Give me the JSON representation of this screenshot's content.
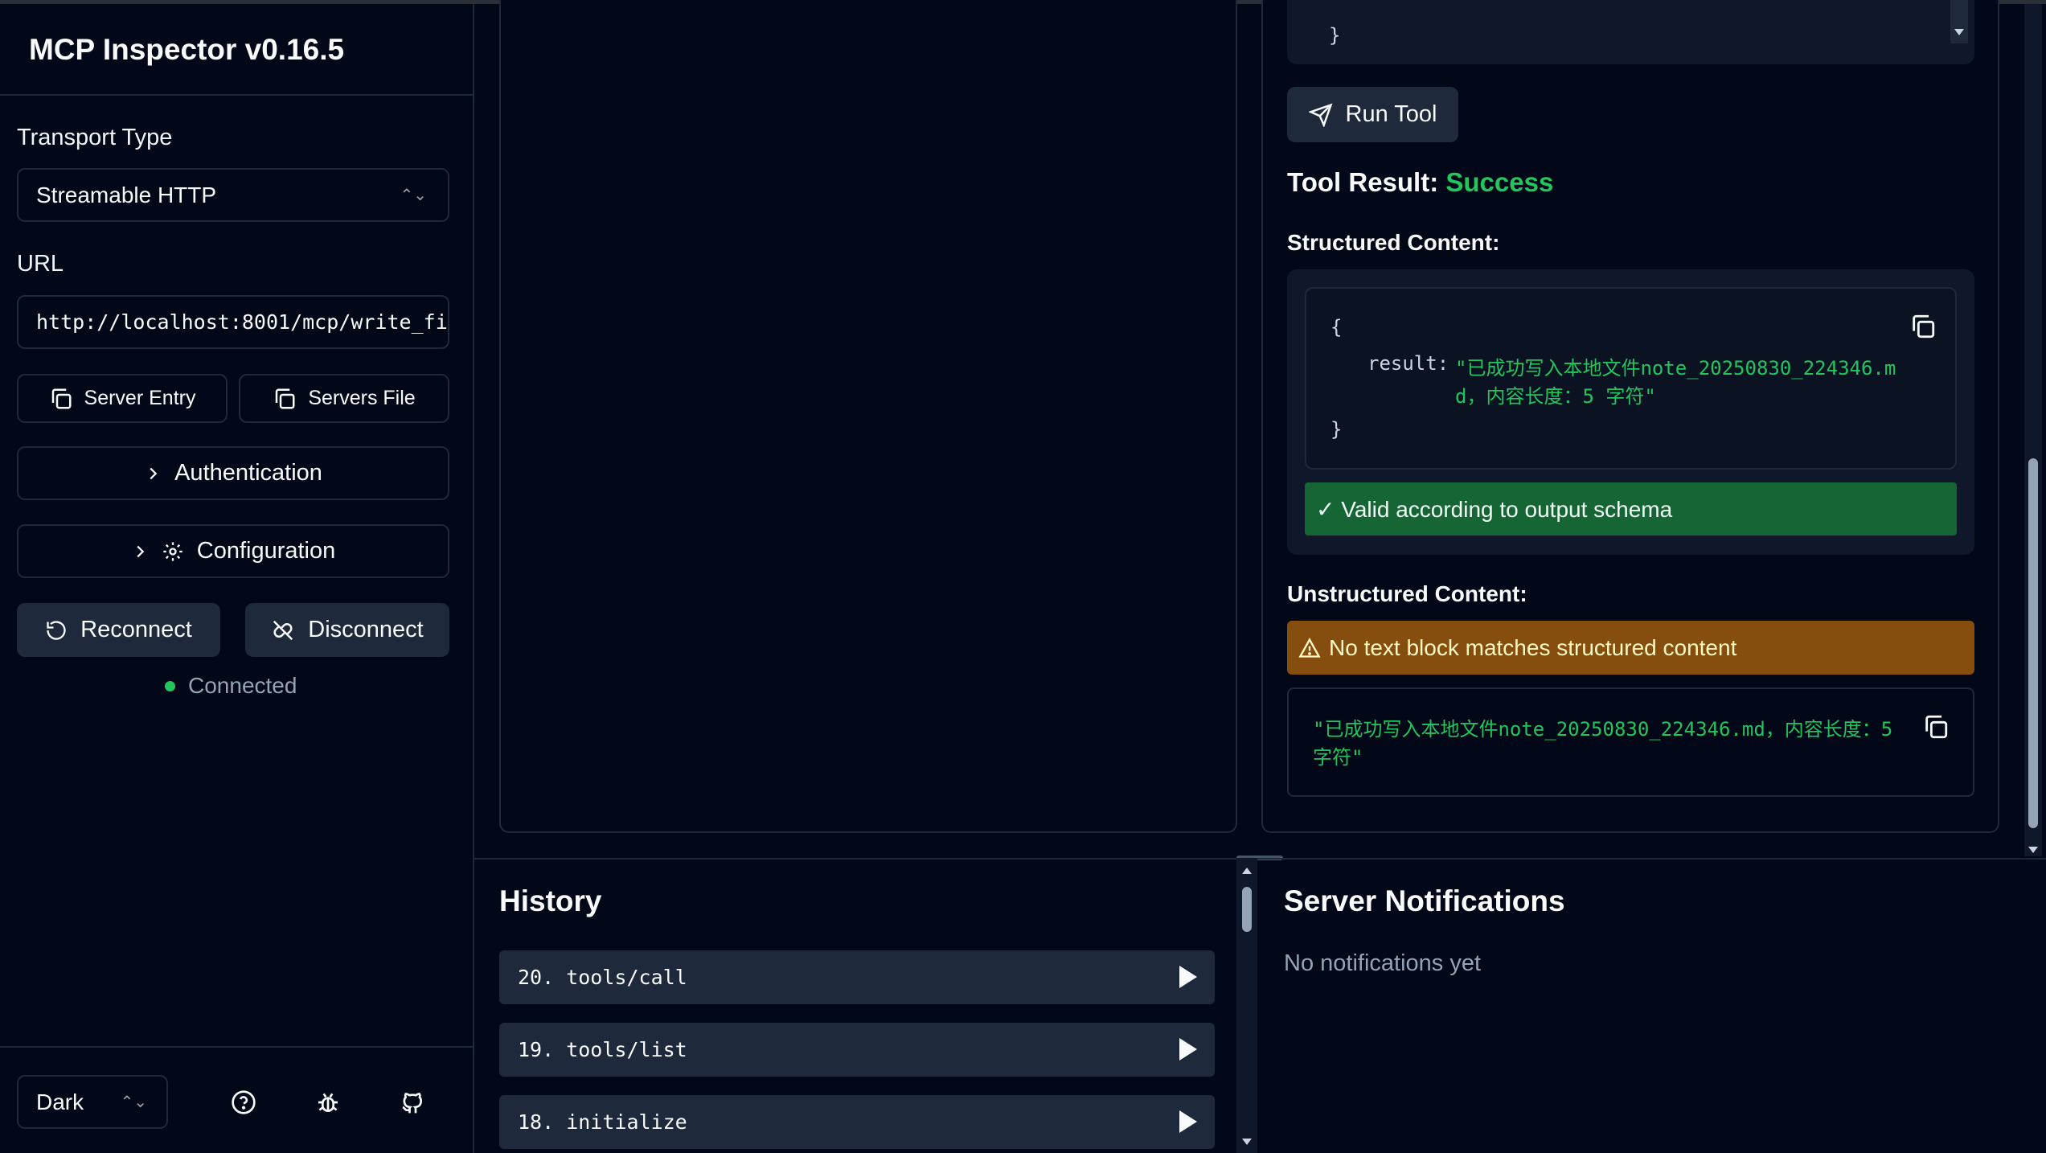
{
  "app": {
    "title": "MCP Inspector v0.16.5"
  },
  "sidebar": {
    "transport_label": "Transport Type",
    "transport_value": "Streamable HTTP",
    "url_label": "URL",
    "url_value": "http://localhost:8001/mcp/write_fi",
    "server_entry_label": "Server Entry",
    "servers_file_label": "Servers File",
    "authentication_label": "Authentication",
    "configuration_label": "Configuration",
    "reconnect_label": "Reconnect",
    "disconnect_label": "Disconnect",
    "status_text": "Connected",
    "status_color": "#22c55e",
    "theme_value": "Dark"
  },
  "tool": {
    "code_top_closing": "}",
    "run_label": "Run Tool",
    "result_label": "Tool Result:",
    "result_status": "Success",
    "structured_label": "Structured Content:",
    "structured_open": "{",
    "structured_key": "result:",
    "structured_value_line1": "\"已成功写入本地文件note_20250830_224346.m",
    "structured_value_line2": "d，内容长度：5 字符\"",
    "structured_close": "}",
    "valid_text": "✓ Valid according to output schema",
    "unstructured_label": "Unstructured Content:",
    "warning_text": "No text block matches structured content",
    "unstructured_line1": "\"已成功写入本地文件note_20250830_224346.md，内容长度：5",
    "unstructured_line2": "字符\""
  },
  "history": {
    "title": "History",
    "items": [
      {
        "label": "20. tools/call"
      },
      {
        "label": "19. tools/list"
      },
      {
        "label": "18. initialize"
      }
    ]
  },
  "notifications": {
    "title": "Server Notifications",
    "empty_text": "No notifications yet"
  }
}
